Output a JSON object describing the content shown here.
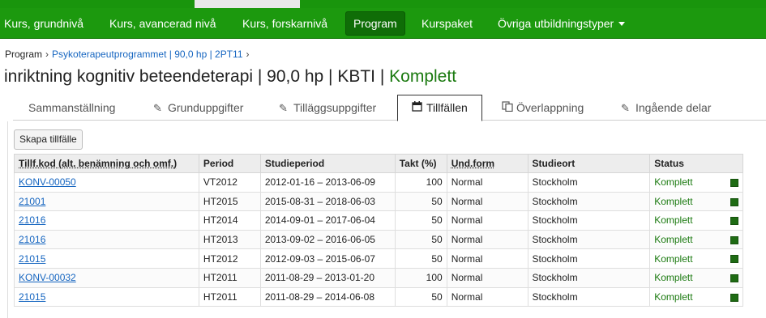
{
  "nav": {
    "items": [
      {
        "label": "Kurs, grundnivå",
        "active": false
      },
      {
        "label": "Kurs, avancerad nivå",
        "active": false
      },
      {
        "label": "Kurs, forskarnivå",
        "active": false
      },
      {
        "label": "Program",
        "active": true
      },
      {
        "label": "Kurspaket",
        "active": false
      },
      {
        "label": "Övriga utbildningstyper",
        "active": false,
        "dropdown": true
      }
    ]
  },
  "breadcrumb": {
    "root": "Program",
    "link": "Psykoterapeutprogrammet | 90,0 hp | 2PT11"
  },
  "title": {
    "main": "inriktning kognitiv beteendeterapi | 90,0 hp | KBTI |",
    "status": "Komplett"
  },
  "tabs": [
    {
      "label": "Sammanställning",
      "icon": "",
      "active": false
    },
    {
      "label": "Grunduppgifter",
      "icon": "pencil-icon",
      "active": false
    },
    {
      "label": "Tilläggsuppgifter",
      "icon": "pencil-icon",
      "active": false
    },
    {
      "label": "Tillfällen",
      "icon": "calendar-icon",
      "active": true
    },
    {
      "label": "Överlappning",
      "icon": "copy-icon",
      "active": false
    },
    {
      "label": "Ingående delar",
      "icon": "pencil-icon",
      "active": false
    }
  ],
  "create_button": "Skapa tillfälle",
  "table": {
    "headers": [
      "Tillf.kod (alt. benämning och omf.)",
      "Period",
      "Studieperiod",
      "Takt (%)",
      "Und.form",
      "Studieort",
      "Status"
    ],
    "rows": [
      {
        "code": "KONV-00050",
        "period": "VT2012",
        "studieperiod": "2012-01-16 – 2013-06-09",
        "takt": "100",
        "undform": "Normal",
        "ort": "Stockholm",
        "status": "Komplett"
      },
      {
        "code": "21001",
        "period": "HT2015",
        "studieperiod": "2015-08-31 – 2018-06-03",
        "takt": "50",
        "undform": "Normal",
        "ort": "Stockholm",
        "status": "Komplett"
      },
      {
        "code": "21016",
        "period": "HT2014",
        "studieperiod": "2014-09-01 – 2017-06-04",
        "takt": "50",
        "undform": "Normal",
        "ort": "Stockholm",
        "status": "Komplett"
      },
      {
        "code": "21016",
        "period": "HT2013",
        "studieperiod": "2013-09-02 – 2016-06-05",
        "takt": "50",
        "undform": "Normal",
        "ort": "Stockholm",
        "status": "Komplett"
      },
      {
        "code": "21015",
        "period": "HT2012",
        "studieperiod": "2012-09-03 – 2015-06-07",
        "takt": "50",
        "undform": "Normal",
        "ort": "Stockholm",
        "status": "Komplett"
      },
      {
        "code": "KONV-00032",
        "period": "HT2011",
        "studieperiod": "2011-08-29 – 2013-01-20",
        "takt": "100",
        "undform": "Normal",
        "ort": "Stockholm",
        "status": "Komplett"
      },
      {
        "code": "21015",
        "period": "HT2011",
        "studieperiod": "2011-08-29 – 2014-06-08",
        "takt": "50",
        "undform": "Normal",
        "ort": "Stockholm",
        "status": "Komplett"
      }
    ]
  },
  "colors": {
    "nav_green": "#1c990e",
    "status_green": "#1b7a10",
    "link_blue": "#1565c0"
  }
}
